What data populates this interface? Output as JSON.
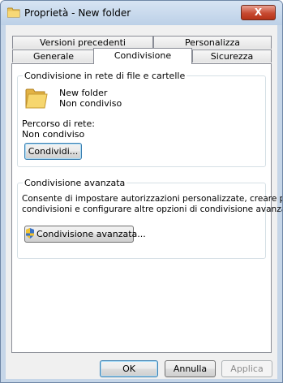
{
  "window": {
    "title": "Proprietà - New folder",
    "close_label": "X"
  },
  "tabs": {
    "row_back": [
      "Versioni precedenti",
      "Personalizza"
    ],
    "row_front": [
      "Generale",
      "Condivisione",
      "Sicurezza"
    ],
    "active": "Condivisione"
  },
  "network_sharing": {
    "group_title": "Condivisione in rete di file e cartelle",
    "folder_name": "New folder",
    "folder_status": "Non condiviso",
    "path_label": "Percorso di rete:",
    "path_value": "Non condiviso",
    "share_button": "Condividi..."
  },
  "advanced_sharing": {
    "group_title": "Condivisione avanzata",
    "description_line1": "Consente di impostare autorizzazioni personalizzate, creare più",
    "description_line2": "condivisioni e configurare altre opzioni di condivisione avanzate.",
    "button": "Condivisione avanzata..."
  },
  "footer": {
    "ok": "OK",
    "cancel": "Annulla",
    "apply": "Applica"
  },
  "icons": {
    "title": "folder-icon",
    "folder": "folder-icon",
    "shield": "uac-shield-icon"
  },
  "colors": {
    "titlebar": "#c6d6e8",
    "close_button": "#c74a31",
    "default_button_border": "#3c7fb1"
  }
}
